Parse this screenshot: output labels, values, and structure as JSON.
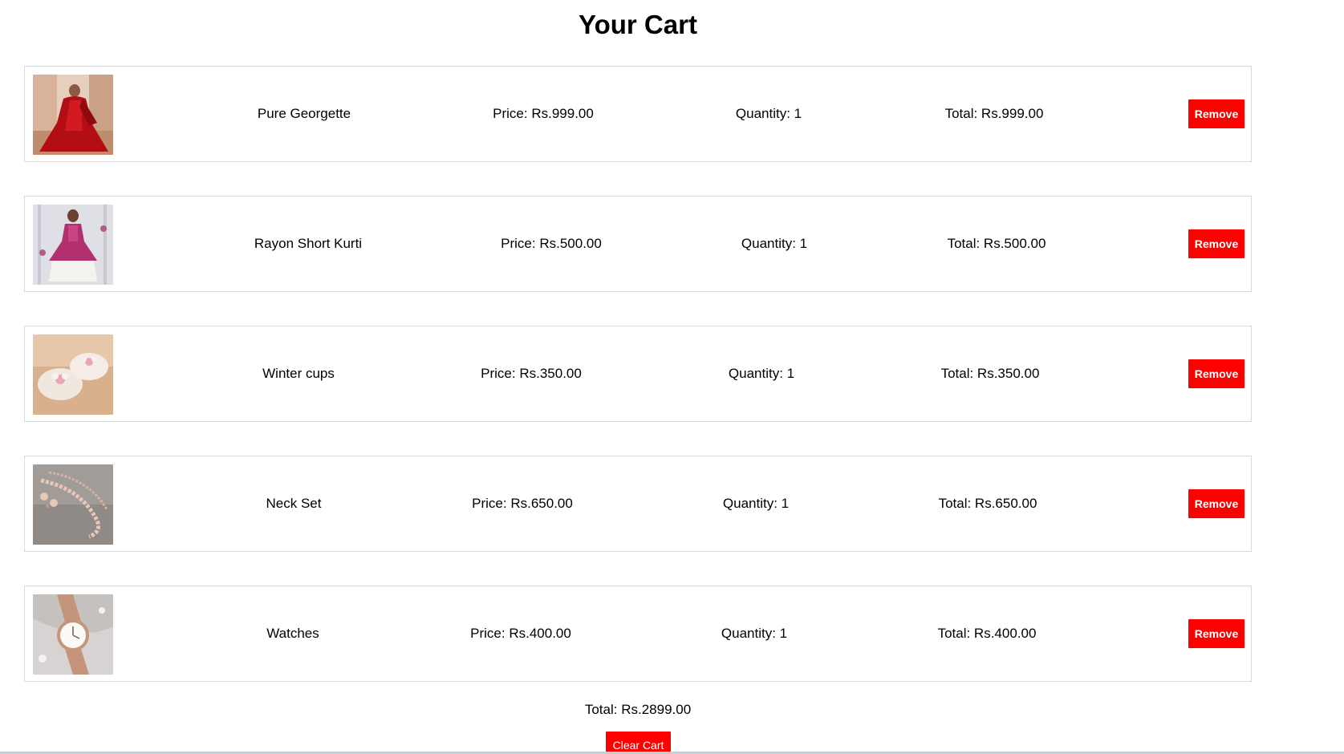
{
  "cart": {
    "title": "Your Cart",
    "items": [
      {
        "name": "Pure Georgette",
        "price": "Price: Rs.999.00",
        "quantity": "Quantity: 1",
        "total": "Total: Rs.999.00",
        "remove_label": "Remove",
        "image": "red-saree-photo"
      },
      {
        "name": "Rayon Short Kurti",
        "price": "Price: Rs.500.00",
        "quantity": "Quantity: 1",
        "total": "Total: Rs.500.00",
        "remove_label": "Remove",
        "image": "magenta-kurti-photo"
      },
      {
        "name": "Winter cups",
        "price": "Price: Rs.350.00",
        "quantity": "Quantity: 1",
        "total": "Total: Rs.350.00",
        "remove_label": "Remove",
        "image": "fluffy-slippers-photo"
      },
      {
        "name": "Neck Set",
        "price": "Price: Rs.650.00",
        "quantity": "Quantity: 1",
        "total": "Total: Rs.650.00",
        "remove_label": "Remove",
        "image": "necklace-set-photo"
      },
      {
        "name": "Watches",
        "price": "Price: Rs.400.00",
        "quantity": "Quantity: 1",
        "total": "Total: Rs.400.00",
        "remove_label": "Remove",
        "image": "rose-gold-watch-photo"
      }
    ],
    "grand_total": "Total: Rs.2899.00",
    "clear_label": "Clear Cart"
  },
  "colors": {
    "accent": "#ff0000",
    "border": "#d9d9d9",
    "background": "#ffffff"
  }
}
